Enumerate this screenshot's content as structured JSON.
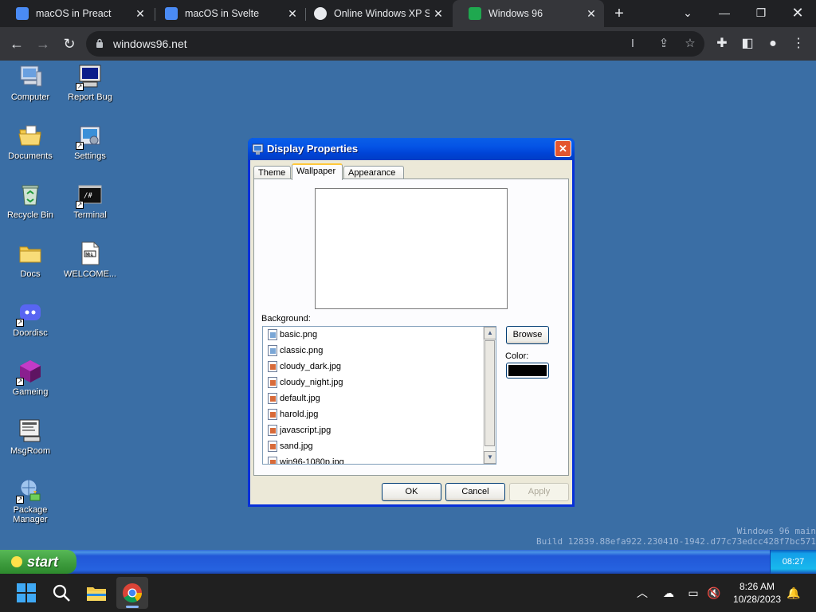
{
  "browser": {
    "tabs": [
      {
        "title": "macOS in Preact"
      },
      {
        "title": "macOS in Svelte"
      },
      {
        "title": "Online Windows XP Si"
      },
      {
        "title": "Windows 96"
      }
    ],
    "url": "windows96.net"
  },
  "desktop": {
    "icons": [
      {
        "label": "Computer",
        "icon": "computer-icon"
      },
      {
        "label": "Report Bug",
        "icon": "report-bug-icon"
      },
      {
        "label": "Documents",
        "icon": "documents-icon"
      },
      {
        "label": "Settings",
        "icon": "settings-icon"
      },
      {
        "label": "Recycle Bin",
        "icon": "recycle-bin-icon"
      },
      {
        "label": "Terminal",
        "icon": "terminal-icon"
      },
      {
        "label": "Docs",
        "icon": "folder-icon"
      },
      {
        "label": "WELCOME...",
        "icon": "markdown-file-icon"
      },
      {
        "label": "Doordisc",
        "icon": "doordisc-icon"
      },
      {
        "label": "Gameing",
        "icon": "gameing-icon"
      },
      {
        "label": "MsgRoom",
        "icon": "msgroom-icon"
      },
      {
        "label": "Package Manager",
        "icon": "package-manager-icon"
      }
    ],
    "build_line1": "Windows 96 main",
    "build_line2": "Build 12839.88efa922.230410-1942.d77c73edcc428f7bc571"
  },
  "dialog": {
    "title": "Display Properties",
    "close": "✕",
    "tabs": [
      "Theme",
      "Wallpaper",
      "Appearance"
    ],
    "selected_tab": "Wallpaper",
    "background_label": "Background:",
    "files": [
      "basic.png",
      "classic.png",
      "cloudy_dark.jpg",
      "cloudy_night.jpg",
      "default.jpg",
      "harold.jpg",
      "javascript.jpg",
      "sand.jpg",
      "win96-1080p.jpg"
    ],
    "browse": "Browse",
    "color_label": "Color:",
    "color_value": "#000000",
    "ok": "OK",
    "cancel": "Cancel",
    "apply": "Apply"
  },
  "xp_taskbar": {
    "start": "start",
    "time": "08:27"
  },
  "system": {
    "time": "8:26 AM",
    "date": "10/28/2023"
  }
}
